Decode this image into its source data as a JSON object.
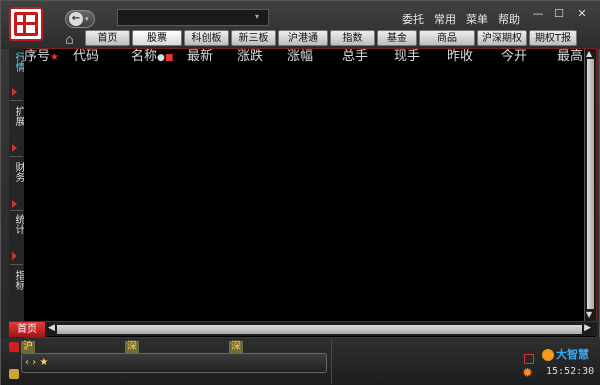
{
  "window": {
    "menus": [
      "委托",
      "常用",
      "菜单",
      "帮助"
    ],
    "controls": {
      "minimize": "—",
      "maximize": "☐",
      "close": "✕"
    }
  },
  "nav": {
    "back_glyph": "←",
    "drop_glyph": "▾"
  },
  "search": {
    "value": "",
    "placeholder": ""
  },
  "tabs": [
    {
      "label": "首页"
    },
    {
      "label": "股票",
      "active": true
    },
    {
      "label": "科创板"
    },
    {
      "label": "新三板"
    },
    {
      "label": "沪港通"
    },
    {
      "label": "指数"
    },
    {
      "label": "基金"
    },
    {
      "label": "商品"
    },
    {
      "label": "沪深期权"
    },
    {
      "label": "期权T报价"
    }
  ],
  "sidebar": {
    "items": [
      {
        "label": "行情",
        "active": true
      },
      {
        "label": "扩展"
      },
      {
        "label": "财务"
      },
      {
        "label": "统计"
      },
      {
        "label": "指标"
      }
    ]
  },
  "table": {
    "columns": [
      "序号",
      "代码",
      "名称",
      "最新",
      "涨跌",
      "涨幅",
      "总手",
      "现手",
      "昨收",
      "今开",
      "最高"
    ],
    "rows": []
  },
  "bottom": {
    "home_tab": "首页"
  },
  "indices": [
    "沪",
    "深",
    "深"
  ],
  "index_bar": {
    "controls": "‹ › ★"
  },
  "brand": {
    "name": "大智慧"
  },
  "status": {
    "time": "15:52:30"
  },
  "colors": {
    "accent_red": "#c31a1a",
    "column_text": "#dcdcdc",
    "active_blue": "#5cd2e6",
    "brand_blue": "#39a6f0"
  }
}
